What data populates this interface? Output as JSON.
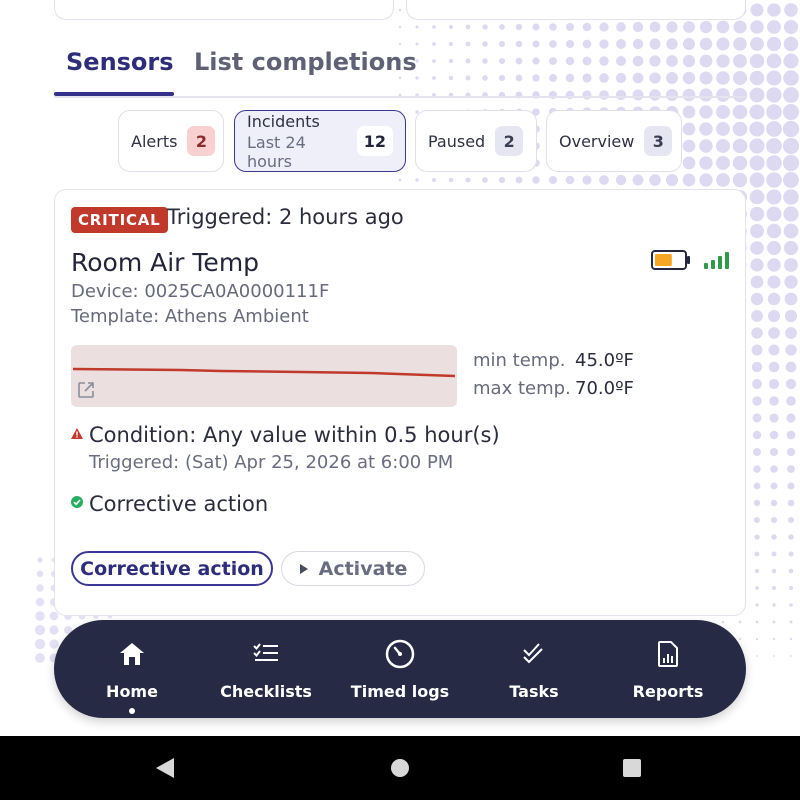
{
  "tabs": [
    {
      "label": "Sensors",
      "active": true
    },
    {
      "label": "List completions",
      "active": false
    }
  ],
  "filters": [
    {
      "label": "Alerts",
      "sublabel": "",
      "count": "2",
      "badge_bg": "#f8d0d0",
      "badge_fg": "#8a2a2a"
    },
    {
      "label": "Incidents",
      "sublabel": "Last 24 hours",
      "count": "12",
      "badge_bg": "#ffffff",
      "badge_fg": "#23253a",
      "selected": true
    },
    {
      "label": "Paused",
      "sublabel": "",
      "count": "2",
      "badge_bg": "#e6e6f2",
      "badge_fg": "#3b3d55"
    },
    {
      "label": "Overview",
      "sublabel": "",
      "count": "3",
      "badge_bg": "#e6e6f2",
      "badge_fg": "#3b3d55"
    }
  ],
  "incident": {
    "severity": "CRITICAL",
    "triggered": "Triggered: 2 hours ago",
    "sensor_name": "Room Air Temp",
    "device": "Device: 0025CA0A0000111F",
    "template": "Template: Athens Ambient",
    "min_label": "min temp.",
    "min_value": "45.0ºF",
    "max_label": "max temp.",
    "max_value": "70.0ºF",
    "condition": "Condition: Any value within 0.5 hour(s)",
    "condition_triggered": "Triggered: (Sat) Apr 25, 2026 at 6:00 PM",
    "corrective_text": "Corrective action",
    "battery_level": 0.6,
    "signal_bars": 4,
    "colors": {
      "critical": "#c0392b",
      "battery": "#f5a623",
      "signal": "#2e9a4a",
      "ok": "#27ae60"
    }
  },
  "actions": {
    "corrective_button": "Corrective action",
    "activate_button": "Activate"
  },
  "bottom_nav": [
    {
      "label": "Home",
      "icon": "home-icon",
      "active": true
    },
    {
      "label": "Checklists",
      "icon": "checklist-icon"
    },
    {
      "label": "Timed logs",
      "icon": "timer-icon"
    },
    {
      "label": "Tasks",
      "icon": "double-check-icon"
    },
    {
      "label": "Reports",
      "icon": "report-icon"
    }
  ]
}
